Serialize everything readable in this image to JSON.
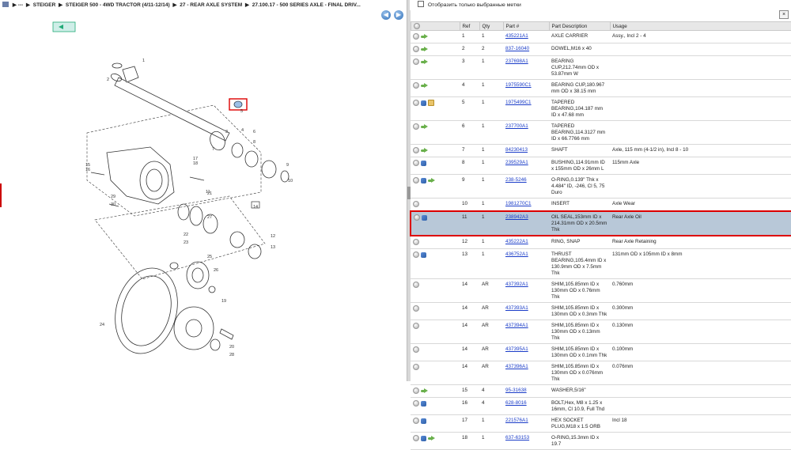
{
  "breadcrumb": {
    "items": [
      "---",
      "STEIGER",
      "STEIGER 500 - 4WD TRACTOR (4/11-12/14)",
      "27 - REAR AXLE SYSTEM",
      "27.100.17 - 500 SERIES AXLE - FINAL DRIV..."
    ]
  },
  "nav": {
    "back_icon": "arrow-left-icon",
    "forward_icon": "arrow-right-icon"
  },
  "filter": {
    "label": "Отобразить только выбранные метки"
  },
  "table": {
    "headers": [
      "",
      "Ref",
      "Qty",
      "Part #",
      "Part Description",
      "Usage"
    ],
    "rows": [
      {
        "icons": [
          "info",
          "arrow"
        ],
        "ref": "1",
        "qty": "1",
        "part": "435221A1",
        "desc": "AXLE CARRIER",
        "usage": "Assy., Incl 2 - 4"
      },
      {
        "icons": [
          "info",
          "arrow"
        ],
        "ref": "2",
        "qty": "2",
        "part": "837-16040",
        "desc": "DOWEL,M16 x 40",
        "usage": ""
      },
      {
        "icons": [
          "info",
          "arrow"
        ],
        "ref": "3",
        "qty": "1",
        "part": "237698A1",
        "desc": "BEARING CUP,212.74mm OD x 53.87mm W",
        "usage": ""
      },
      {
        "icons": [
          "info",
          "arrow"
        ],
        "ref": "4",
        "qty": "1",
        "part": "1975590C1",
        "desc": "BEARING CUP,180.967 mm OD x 38.15 mm",
        "usage": ""
      },
      {
        "icons": [
          "info",
          "link",
          "box"
        ],
        "ref": "5",
        "qty": "1",
        "part": "1975499C1",
        "desc": "TAPERED BEARING,104.187 mm ID x 47.68 mm",
        "usage": ""
      },
      {
        "icons": [
          "info",
          "arrow"
        ],
        "ref": "6",
        "qty": "1",
        "part": "237700A1",
        "desc": "TAPERED BEARING,114.3127 mm ID x 66.7766 mm",
        "usage": ""
      },
      {
        "icons": [
          "info",
          "arrow"
        ],
        "ref": "7",
        "qty": "1",
        "part": "84230413",
        "desc": "SHAFT",
        "usage": "Axle, 115 mm (4-1/2 in), Incl 8 - 10"
      },
      {
        "icons": [
          "info",
          "link"
        ],
        "ref": "8",
        "qty": "1",
        "part": "239529A1",
        "desc": "BUSHING,114.91mm ID x 155mm OD x 26mm L",
        "usage": "115mm Axle"
      },
      {
        "icons": [
          "info",
          "link",
          "arrow"
        ],
        "ref": "9",
        "qty": "1",
        "part": "238-5246",
        "desc": "O-RING,0.139\" Thk x 4.484\" ID, -246, Cl 5, 75 Duro",
        "usage": ""
      },
      {
        "icons": [
          "info"
        ],
        "ref": "10",
        "qty": "1",
        "part": "1981270C1",
        "desc": "INSERT",
        "usage": "Axle Wear"
      },
      {
        "icons": [
          "info",
          "link"
        ],
        "ref": "11",
        "qty": "1",
        "part": "238942A3",
        "desc": "OIL SEAL,153mm ID x 214.31mm OD x 20.5mm Thk",
        "usage": "Rear Axle Oil",
        "selected": true
      },
      {
        "icons": [
          "info"
        ],
        "ref": "12",
        "qty": "1",
        "part": "435222A1",
        "desc": "RING, SNAP",
        "usage": "Rear Axle Retaining"
      },
      {
        "icons": [
          "info",
          "link"
        ],
        "ref": "13",
        "qty": "1",
        "part": "436752A1",
        "desc": "THRUST BEARING,105.4mm ID x 130.9mm OD x 7.5mm Thk",
        "usage": "131mm OD x 105mm ID x 8mm"
      },
      {
        "icons": [
          "info"
        ],
        "ref": "14",
        "qty": "AR",
        "part": "437392A1",
        "desc": "SHIM,105.85mm ID x 130mm OD x 0.76mm Thk",
        "usage": "0.760mm"
      },
      {
        "icons": [
          "info"
        ],
        "ref": "14",
        "qty": "AR",
        "part": "437393A1",
        "desc": "SHIM,105.85mm ID x 130mm OD x 0.3mm Thk",
        "usage": "0.300mm"
      },
      {
        "icons": [
          "info"
        ],
        "ref": "14",
        "qty": "AR",
        "part": "437394A1",
        "desc": "SHIM,105.85mm ID x 130mm OD x 0.13mm Thk",
        "usage": "0.130mm"
      },
      {
        "icons": [
          "info"
        ],
        "ref": "14",
        "qty": "AR",
        "part": "437395A1",
        "desc": "SHIM,105.85mm ID x 130mm OD x 0.1mm Thk",
        "usage": "0.100mm"
      },
      {
        "icons": [
          "info"
        ],
        "ref": "14",
        "qty": "AR",
        "part": "437396A1",
        "desc": "SHIM,105.85mm ID x 130mm OD x 0.076mm Thk",
        "usage": "0.076mm"
      },
      {
        "icons": [
          "info",
          "arrow"
        ],
        "ref": "15",
        "qty": "4",
        "part": "95-31638",
        "desc": "WASHER,5/16\"",
        "usage": ""
      },
      {
        "icons": [
          "info",
          "link"
        ],
        "ref": "16",
        "qty": "4",
        "part": "628-8016",
        "desc": "BOLT,Hex, M8 x 1.25 x 16mm, Cl 10.9, Full Thd",
        "usage": ""
      },
      {
        "icons": [
          "info",
          "link"
        ],
        "ref": "17",
        "qty": "1",
        "part": "221576A1",
        "desc": "HEX SOCKET PLUG,M18 x 1.5 ORB",
        "usage": "Incl 18"
      },
      {
        "icons": [
          "info",
          "link",
          "arrow"
        ],
        "ref": "18",
        "qty": "1",
        "part": "637-63153",
        "desc": "O-RING,15.3mm ID x 19.7",
        "usage": ""
      }
    ]
  },
  "diagram": {
    "labels": [
      "1",
      "2",
      "3",
      "4",
      "5",
      "6",
      "7",
      "8",
      "9",
      "10",
      "11",
      "12",
      "13",
      "14",
      "15",
      "16",
      "17",
      "18",
      "19",
      "20",
      "21",
      "22",
      "23",
      "24",
      "25",
      "26",
      "27",
      "28",
      "29",
      "30"
    ]
  }
}
